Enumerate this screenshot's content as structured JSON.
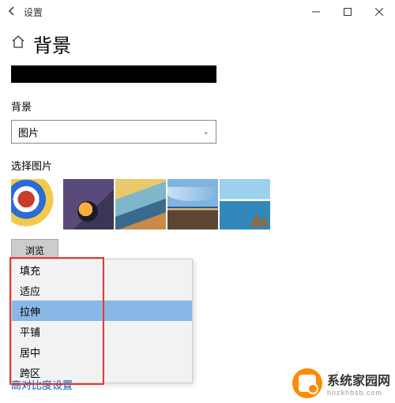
{
  "titlebar": {
    "title": "设置"
  },
  "header": {
    "page_title": "背景"
  },
  "bg_section": {
    "label": "背景",
    "selected": "图片"
  },
  "picker": {
    "label": "选择图片",
    "browse": "浏览"
  },
  "fit_options": [
    "填充",
    "适应",
    "拉伸",
    "平铺",
    "居中",
    "跨区"
  ],
  "fit_selected_index": 2,
  "link": {
    "high_contrast": "高对比度设置"
  },
  "watermark": {
    "brand": "系统家园网",
    "sub": "hnzkhbsb.com"
  }
}
